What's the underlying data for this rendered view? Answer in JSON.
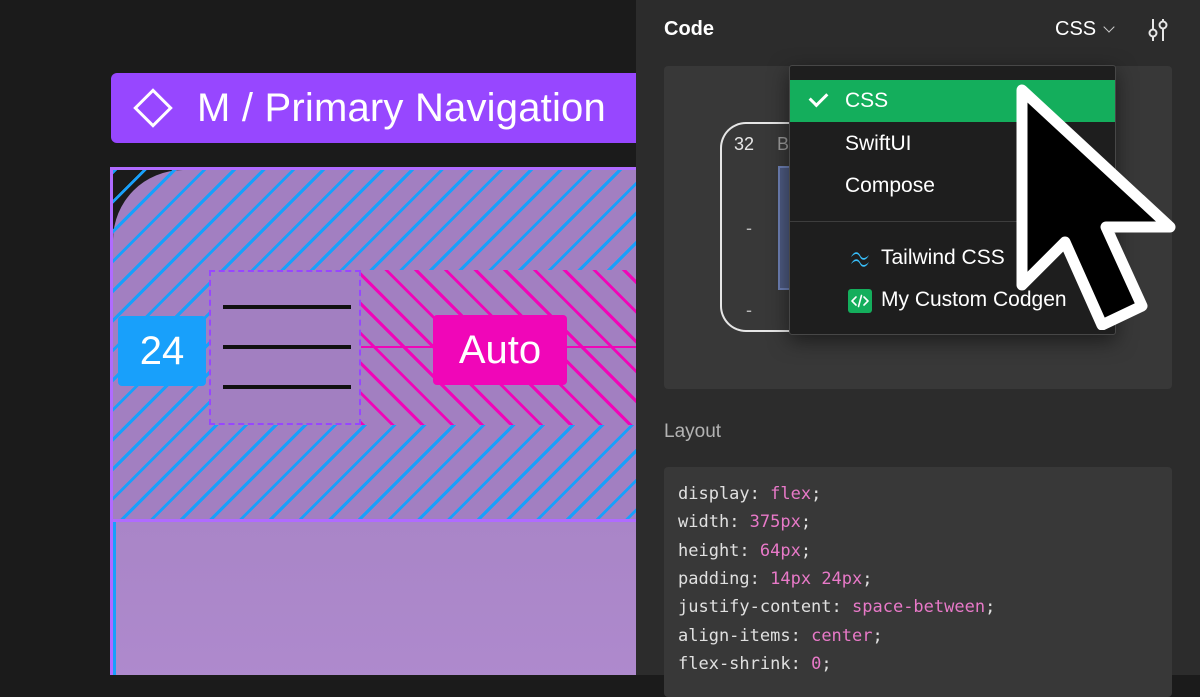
{
  "canvas": {
    "component_label": "M / Primary Navigation",
    "padding_badge": "24",
    "gap_badge": "Auto"
  },
  "panel": {
    "title": "Code",
    "language_selected": "CSS",
    "settings_icon": "settings-sliders-icon",
    "preview": {
      "number": "32",
      "letter": "B",
      "dash_top": "-",
      "dash_bottom": "-"
    },
    "dropdown": {
      "items": [
        {
          "label": "CSS",
          "selected": true
        },
        {
          "label": "SwiftUI",
          "selected": false
        },
        {
          "label": "Compose",
          "selected": false
        }
      ],
      "plugins": [
        {
          "label": "Tailwind CSS",
          "icon": "tailwind-icon"
        },
        {
          "label": "My Custom Codgen",
          "icon": "code-plugin-icon"
        }
      ]
    },
    "layout_section": {
      "label": "Layout",
      "code": [
        {
          "prop": "display",
          "value": "flex"
        },
        {
          "prop": "width",
          "value": "375px"
        },
        {
          "prop": "height",
          "value": "64px"
        },
        {
          "prop": "padding",
          "value": "14px 24px"
        },
        {
          "prop": "justify-content",
          "value": "space-between"
        },
        {
          "prop": "align-items",
          "value": "center"
        },
        {
          "prop": "flex-shrink",
          "value": "0"
        }
      ]
    }
  },
  "colors": {
    "selection_purple": "#9747ff",
    "padding_blue": "#18a0fb",
    "gap_pink": "#f006b8",
    "selected_green": "#14ae5c",
    "code_value_pink": "#e879c8"
  }
}
